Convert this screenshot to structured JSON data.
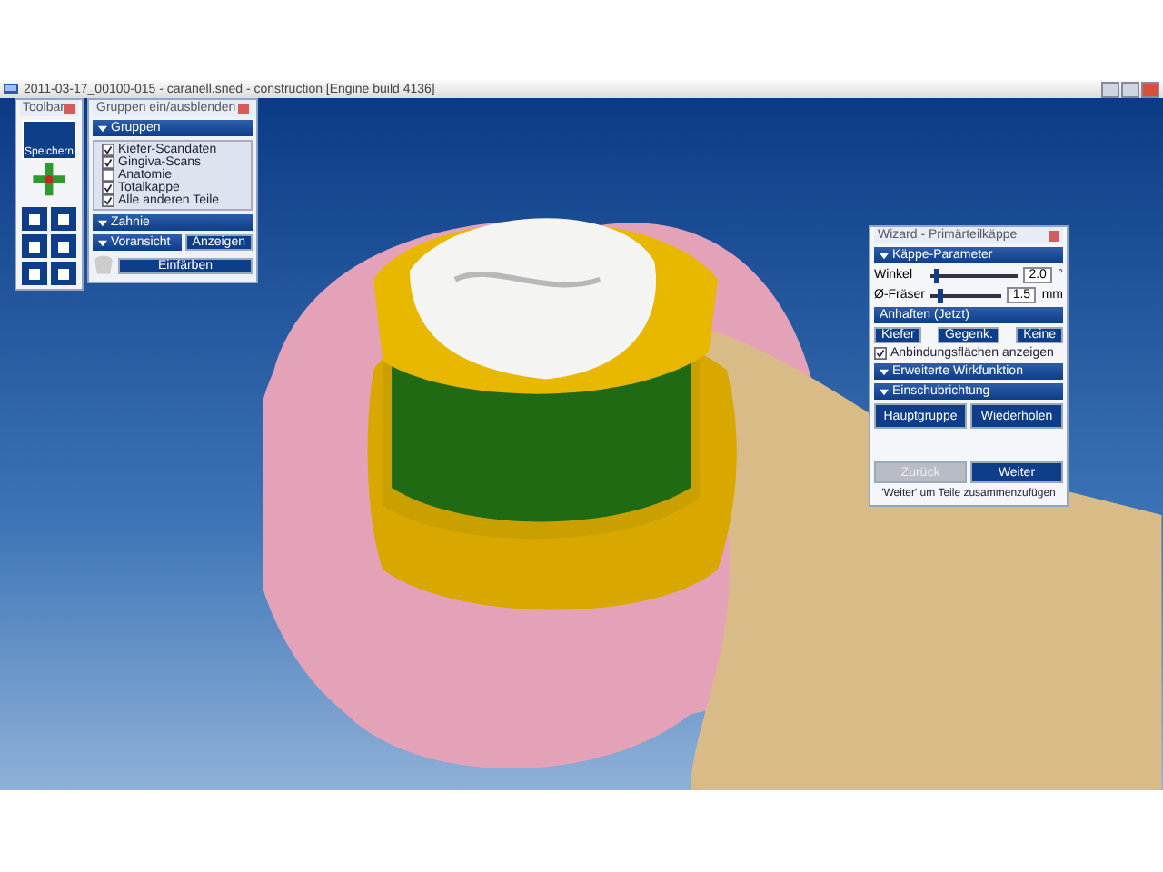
{
  "window": {
    "title": "2011-03-17_00100-015 - caranell.sned - construction [Engine build 4136]"
  },
  "toolbar": {
    "title": "Toolbar",
    "save_button": "Speichern"
  },
  "groups_panel": {
    "title": "Gruppen ein/ausblenden",
    "section": "Gruppen",
    "items": [
      {
        "label": "Kiefer-Scandaten",
        "checked": true
      },
      {
        "label": "Gingiva-Scans",
        "checked": true
      },
      {
        "label": "Anatomie",
        "checked": false
      },
      {
        "label": "Totalkappe",
        "checked": true
      },
      {
        "label": "Alle anderen Teile",
        "checked": true
      }
    ],
    "section_2": "Zahnie",
    "section_3": "Voransicht",
    "show_button": "Anzeigen",
    "color_button": "Einfärben"
  },
  "wizard": {
    "title": "Wizard - Primärteilkäppe",
    "section": "Käppe-Parameter",
    "sliders": [
      {
        "label": "Winkel",
        "level": 0.05,
        "value": "2.0",
        "unit": "°"
      },
      {
        "label": "Ø-Fräser",
        "level": 0.1,
        "value": "1.5",
        "unit": "mm"
      }
    ],
    "attach_section": "Anhaften (Jetzt)",
    "attach_buttons": [
      "Kiefer",
      "Gegenk.",
      "Keine"
    ],
    "show_surfaces": {
      "label": "Anbindungsflächen anzeigen",
      "checked": true
    },
    "section_2": "Erweiterte Wirkfunktion",
    "section_3": "Einschubrichtung",
    "action_buttons": [
      "Hauptgruppe",
      "Wiederholen"
    ],
    "back_button": {
      "label": "Zurück",
      "disabled": true
    },
    "next_button": "Weiter",
    "hint": "'Weiter' um Teile zusammenzufügen"
  }
}
